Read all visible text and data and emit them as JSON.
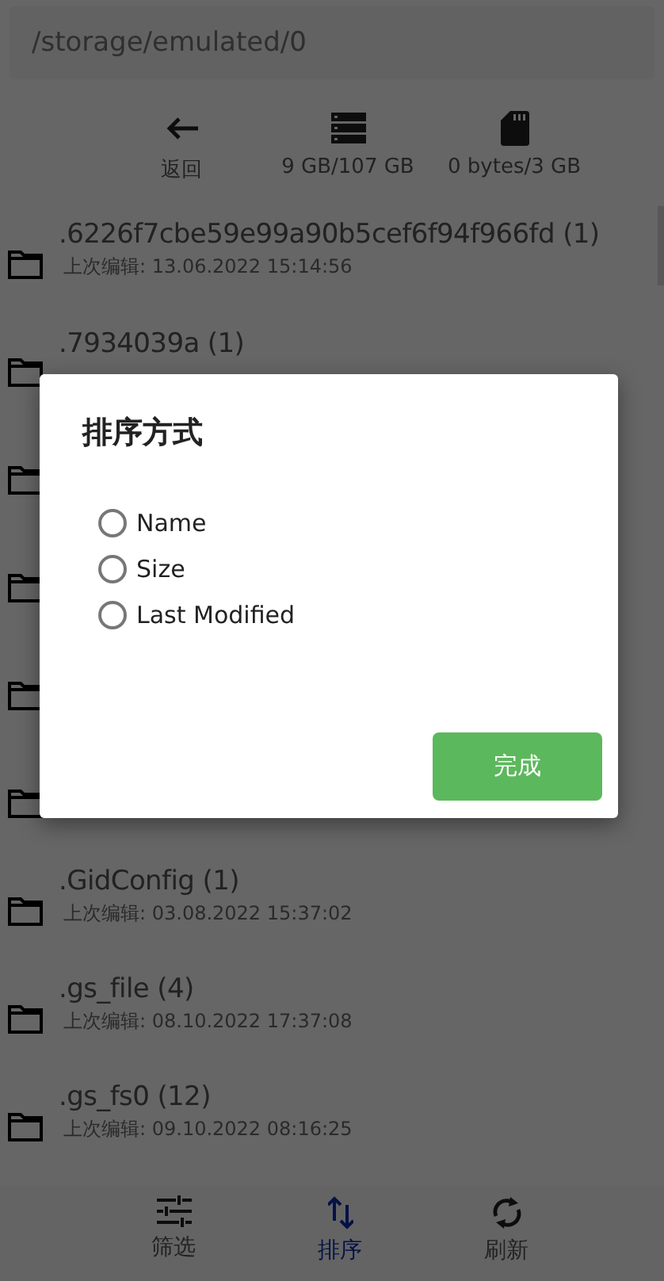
{
  "path_field": {
    "value": "/storage/emulated/0"
  },
  "toolbar": [
    {
      "kind": "back",
      "label": "返回"
    },
    {
      "kind": "storage",
      "label": "9 GB/107 GB"
    },
    {
      "kind": "sdcard",
      "label": "0 bytes/3 GB"
    }
  ],
  "files": [
    {
      "kind": "folder",
      "name": ".6226f7cbe59e99a90b5cef6f94f966fd (1)",
      "modified": "上次编辑: 13.06.2022 15:14:56"
    },
    {
      "kind": "folder",
      "name": ".7934039a (1)"
    },
    {
      "kind": "hidden"
    },
    {
      "kind": "hidden"
    },
    {
      "kind": "hidden"
    },
    {
      "kind": "hidden"
    },
    {
      "kind": "folder",
      "name": ".GidConfig (1)",
      "modified": "上次编辑: 03.08.2022 15:37:02"
    },
    {
      "kind": "folder",
      "name": ".gs_file (4)",
      "modified": "上次编辑: 08.10.2022 17:37:08"
    },
    {
      "kind": "folder",
      "name": ".gs_fs0 (12)",
      "modified": "上次编辑: 09.10.2022 08:16:25"
    }
  ],
  "bottom_nav": [
    {
      "kind": "filter",
      "label": "筛选",
      "selected": false
    },
    {
      "kind": "sort",
      "label": "排序",
      "selected": true
    },
    {
      "kind": "refresh",
      "label": "刷新",
      "selected": false
    }
  ],
  "dialog": {
    "title": "排序方式",
    "options": [
      {
        "label": "Name",
        "selected": false
      },
      {
        "label": "Size",
        "selected": false
      },
      {
        "label": "Last Modified",
        "selected": false
      }
    ],
    "button": "完成"
  }
}
